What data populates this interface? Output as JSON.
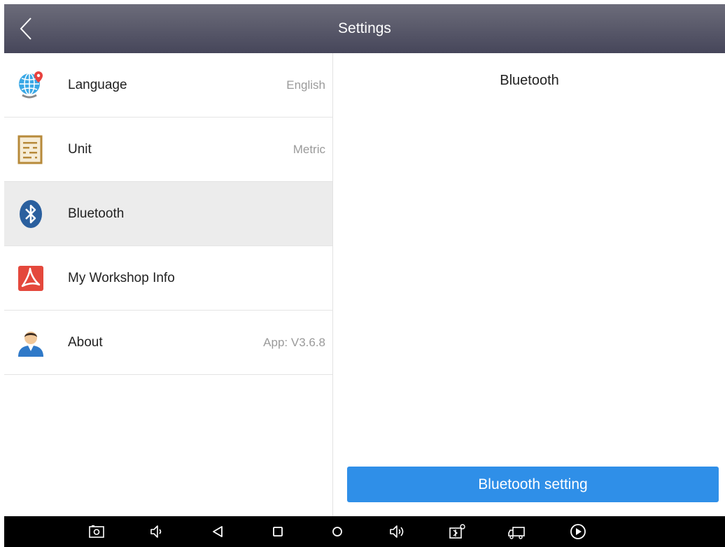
{
  "header": {
    "title": "Settings"
  },
  "menu": {
    "items": [
      {
        "label": "Language",
        "value": "English",
        "icon": "globe-icon"
      },
      {
        "label": "Unit",
        "value": "Metric",
        "icon": "abacus-icon"
      },
      {
        "label": "Bluetooth",
        "value": "",
        "icon": "bluetooth-icon",
        "selected": true
      },
      {
        "label": "My Workshop Info",
        "value": "",
        "icon": "workshop-pdf-icon"
      },
      {
        "label": "About",
        "value": "App: V3.6.8",
        "icon": "user-icon"
      }
    ]
  },
  "panel": {
    "title": "Bluetooth",
    "button_label": "Bluetooth setting"
  },
  "navbar": {
    "icons": [
      "screenshot-icon",
      "volume-down-icon",
      "back-icon",
      "recents-icon",
      "home-icon",
      "volume-up-icon",
      "vci-icon",
      "truck-icon",
      "play-icon"
    ]
  },
  "colors": {
    "accent": "#2f8fe8",
    "header": "#55556a",
    "selected_row": "#ececec"
  }
}
